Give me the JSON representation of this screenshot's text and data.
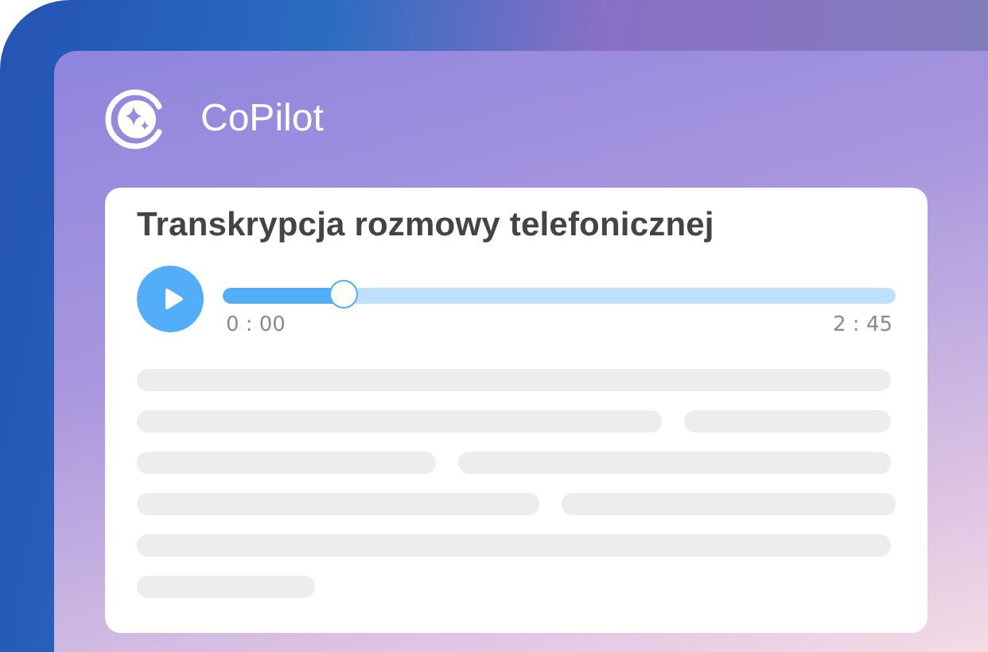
{
  "app": {
    "name": "CoPilot"
  },
  "card": {
    "title": "Transkrypcja rozmowy telefonicznej"
  },
  "player": {
    "level": 0.18,
    "elapsed": "0 : 00",
    "duration": "2 : 45"
  }
}
